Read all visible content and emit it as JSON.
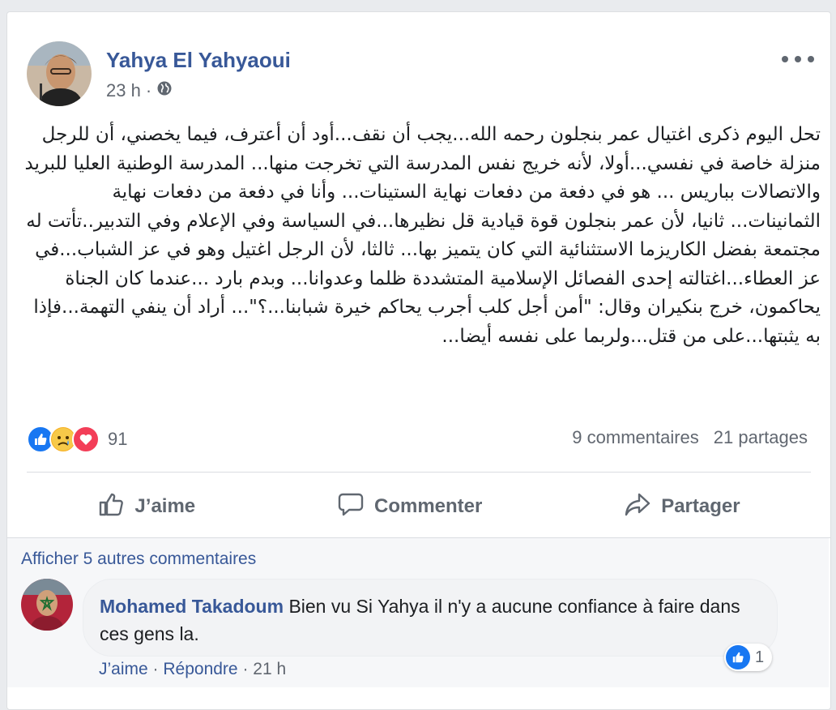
{
  "post": {
    "author": "Yahya El Yahyaoui",
    "time": "23 h",
    "text": "تحل اليوم ذكرى اغتيال عمر بنجلون رحمه الله...يجب أن نقف...أود أن أعترف، فيما يخصني، أن للرجل منزلة خاصة في نفسي...أولا، لأنه خريج نفس المدرسة التي تخرجت منها... المدرسة الوطنية العليا للبريد والاتصالات بباريس ... هو في دفعة من دفعات نهاية الستينات... وأنا في دفعة من دفعات نهاية الثمانينات... ثانيا، لأن عمر بنجلون قوة قيادية قل نظيرها...في السياسة وفي الإعلام وفي التدبير..تأتت له مجتمعة بفضل الكاريزما الاستثنائية التي كان يتميز بها... ثالثا، لأن الرجل اغتيل وهو في عز الشباب...في عز العطاء...اغتالته إحدى الفصائل الإسلامية المتشددة ظلما وعدوانا... وبدم بارد ...عندما كان الجناة يحاكمون، خرج بنكيران وقال: \"أمن أجل كلب أجرب يحاكم خيرة شبابنا...؟\"... أراد أن ينفي التهمة...فإذا به يثبتها...على من قتل...ولربما على نفسه أيضا...",
    "reaction_count": "91",
    "comments_count": "9 commentaires",
    "shares_count": "21 partages"
  },
  "actions": {
    "like": "J’aime",
    "comment": "Commenter",
    "share": "Partager"
  },
  "comments": {
    "view_more": "Afficher 5 autres commentaires",
    "items": [
      {
        "author": "Mohamed Takadoum",
        "text": "Bien vu Si Yahya il n'y a aucune confiance à faire dans ces gens la.",
        "like_label": "J’aime",
        "reply_label": "Répondre",
        "time": "21 h",
        "reaction_count": "1"
      }
    ]
  },
  "icons": {
    "globe": "globe-icon",
    "more": "more-options-icon",
    "like_reaction": "like-reaction-icon",
    "sad_reaction": "sad-reaction-icon",
    "love_reaction": "love-reaction-icon",
    "thumb": "thumbs-up-icon",
    "comment": "comment-icon",
    "share": "share-icon"
  },
  "colors": {
    "link": "#385898",
    "like_blue": "#1877f2",
    "love_red": "#f33e58",
    "sad_yellow": "#f7b125"
  }
}
